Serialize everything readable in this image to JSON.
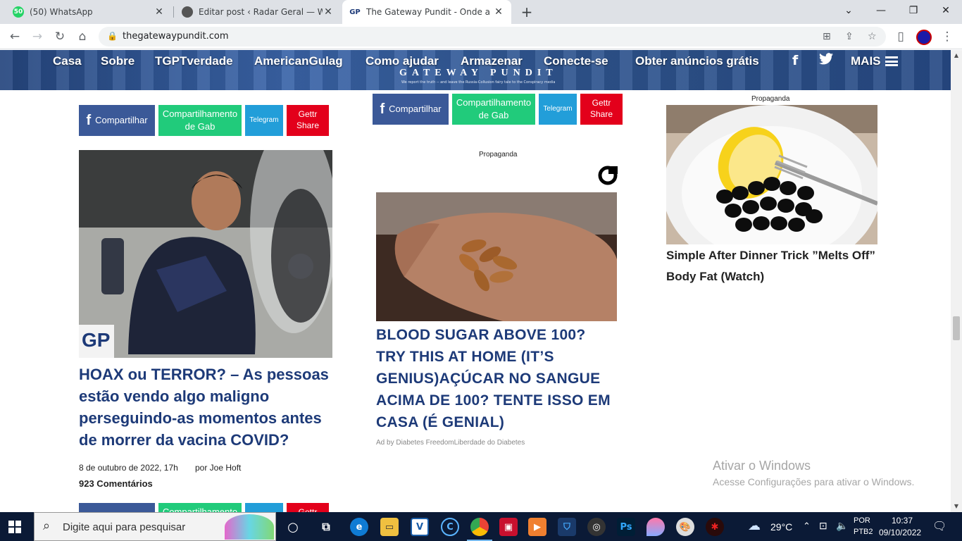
{
  "tabs": [
    {
      "title": "(50) WhatsApp",
      "favicon": "50"
    },
    {
      "title": "Editar post ‹ Radar Geral — WordPress",
      "favicon": ""
    },
    {
      "title": "The Gateway Pundit - Onde a esperança termina",
      "favicon": "GP"
    }
  ],
  "window_controls": {
    "minimize": "—",
    "maximize": "❐",
    "close": "✕",
    "tabs_dropdown": "⌄"
  },
  "new_tab_glyph": "+",
  "toolbar": {
    "url": "thegatewaypundit.com"
  },
  "site": {
    "nav": [
      "Casa",
      "Sobre",
      "TGPTverdade",
      "AmericanGulag",
      "Como ajudar",
      "Armazenar",
      "Conecte-se",
      "Obter anúncios grátis"
    ],
    "more_label": "MAIS",
    "logo": "GATEWAY PUNDIT",
    "tagline": "We report the truth -- and leave the Russia-Collusion fairy tale to the Conspiracy media"
  },
  "share": {
    "facebook": "Compartilhar",
    "gab": "Compartilhamento de Gab",
    "telegram": "Telegram",
    "gettr": "Gettr Share"
  },
  "left_article": {
    "badge": "GP",
    "headline": "HOAX ou TERROR? – As pessoas estão vendo algo maligno perseguindo-as momentos antes de morrer da vacina COVID?",
    "date": "8 de outubro de 2022, 17h",
    "author": "por Joe Hoft",
    "comments": "923 Comentários"
  },
  "middle_ad": {
    "label": "Propaganda",
    "headline": "BLOOD SUGAR ABOVE 100? TRY THIS AT HOME (IT’S GENIUS)AÇÚCAR NO SANGUE ACIMA DE 100? TENTE ISSO EM CASA (É GENIAL)",
    "byline": "Ad by Diabetes FreedomLiberdade do Diabetes"
  },
  "right_ad": {
    "label": "Propaganda",
    "headline": "Simple After Dinner Trick ”Melts Off” Body Fat (Watch)"
  },
  "watermark": {
    "title": "Ativar o Windows",
    "subtitle": "Acesse Configurações para ativar o Windows."
  },
  "taskbar": {
    "search_placeholder": "Digite aqui para pesquisar",
    "weather": "29°C",
    "lang_top": "POR",
    "lang_bottom": "PTB2",
    "time": "10:37",
    "date": "09/10/2022"
  }
}
